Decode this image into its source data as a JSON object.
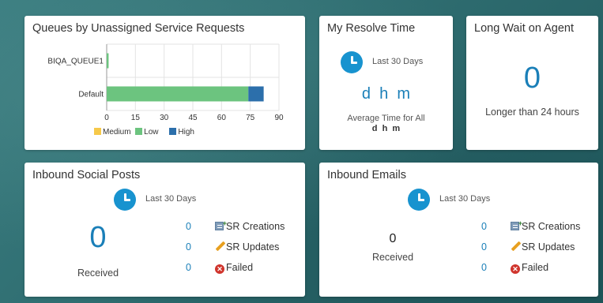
{
  "colors": {
    "medium": "#f6c94a",
    "low": "#6cc47f",
    "high": "#2c6fab",
    "accent": "#1a7fb8"
  },
  "queues_card": {
    "title": "Queues by Unassigned Service Requests",
    "legend": [
      "Medium",
      "Low",
      "High"
    ]
  },
  "chart_data": {
    "type": "bar",
    "orientation": "horizontal",
    "stacked": true,
    "categories": [
      "BIQA_QUEUE1",
      "Default"
    ],
    "series": [
      {
        "name": "Medium",
        "values": [
          0,
          0
        ]
      },
      {
        "name": "Low",
        "values": [
          1,
          74
        ]
      },
      {
        "name": "High",
        "values": [
          0,
          8
        ]
      }
    ],
    "xticks": [
      "0",
      "15",
      "30",
      "45",
      "60",
      "75",
      "90"
    ],
    "xlim": [
      0,
      90
    ],
    "legend_position": "bottom"
  },
  "resolve_card": {
    "title": "My Resolve Time",
    "period": "Last 30 Days",
    "value": "d  h  m",
    "avg_label": "Average Time for All",
    "avg_value": "d  h  m",
    "clock_icon": "clock-icon"
  },
  "longwait_card": {
    "title": "Long Wait on Agent",
    "value": "0",
    "subtitle": "Longer than 24 hours"
  },
  "social_card": {
    "title": "Inbound Social Posts",
    "period": "Last 30 Days",
    "received_value": "0",
    "received_label": "Received",
    "metrics": [
      {
        "value": "0",
        "label": "SR Creations",
        "icon": "sr-creation-icon"
      },
      {
        "value": "0",
        "label": "SR Updates",
        "icon": "pencil-icon"
      },
      {
        "value": "0",
        "label": "Failed",
        "icon": "failed-icon"
      }
    ]
  },
  "emails_card": {
    "title": "Inbound Emails",
    "period": "Last 30 Days",
    "received_value": "0",
    "received_label": "Received",
    "metrics": [
      {
        "value": "0",
        "label": "SR Creations",
        "icon": "sr-creation-icon"
      },
      {
        "value": "0",
        "label": "SR Updates",
        "icon": "pencil-icon"
      },
      {
        "value": "0",
        "label": "Failed",
        "icon": "failed-icon"
      }
    ]
  }
}
